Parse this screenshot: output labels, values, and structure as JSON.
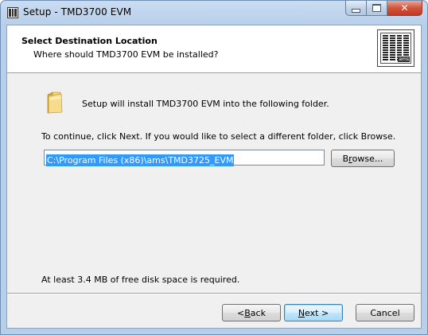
{
  "window": {
    "title": "Setup - TMD3700 EVM",
    "close_glyph": "✕"
  },
  "header": {
    "title": "Select Destination Location",
    "subtitle": "Where should TMD3700 EVM be installed?",
    "logo_icon": "ams-logo-icon"
  },
  "body": {
    "install_text": "Setup will install TMD3700 EVM into the following folder.",
    "continue_text": "To continue, click Next. If you would like to select a different folder, click Browse.",
    "path_value": "C:\\Program Files (x86)\\ams\\TMD3725_EVM",
    "disk_text": "At least 3.4 MB of free disk space is required."
  },
  "buttons": {
    "browse_pre": "B",
    "browse_accel": "r",
    "browse_post": "owse...",
    "back_pre": "< ",
    "back_accel": "B",
    "back_post": "ack",
    "next_accel": "N",
    "next_post": "ext >",
    "cancel": "Cancel"
  },
  "colors": {
    "selection": "#3399ff",
    "close_button": "#c13a22"
  }
}
